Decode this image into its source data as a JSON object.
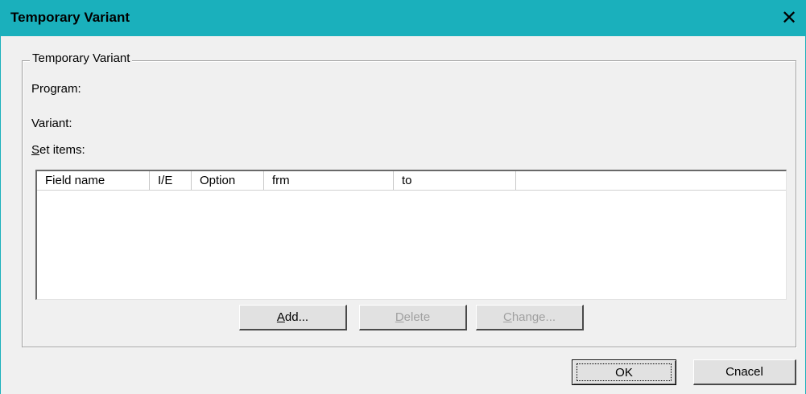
{
  "window": {
    "title": "Temporary Variant",
    "close_glyph": "✕"
  },
  "group": {
    "legend": "Temporary Variant"
  },
  "labels": {
    "program": "Program:",
    "variant": "Variant:",
    "set_items_accel": "S",
    "set_items_rest": "et items:"
  },
  "table": {
    "columns": [
      "Field name",
      "I/E",
      "Option",
      "frm",
      "to",
      ""
    ],
    "rows": []
  },
  "buttons": {
    "add_accel": "A",
    "add_rest": "dd...",
    "delete_accel": "D",
    "delete_rest": "elete",
    "change_accel": "C",
    "change_rest": "hange...",
    "ok": "OK",
    "cancel": "Cnacel"
  },
  "colors": {
    "titlebar": "#1ab0bc",
    "background": "#f0f0f0"
  }
}
